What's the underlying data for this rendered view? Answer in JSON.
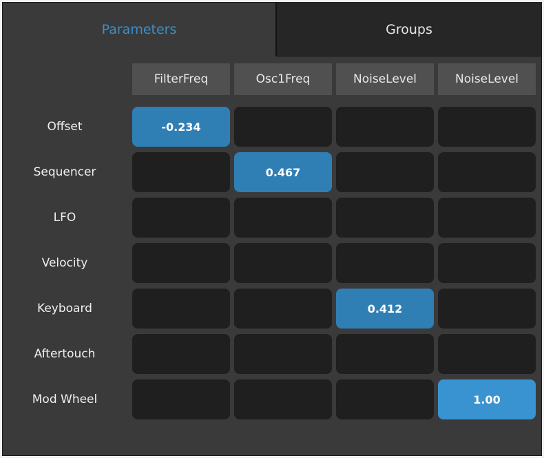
{
  "tabs": {
    "parameters": "Parameters",
    "groups": "Groups"
  },
  "columns": [
    "FilterFreq",
    "Osc1Freq",
    "NoiseLevel",
    "NoiseLevel"
  ],
  "rows": [
    {
      "label": "Offset",
      "cells": [
        "-0.234",
        "",
        "",
        ""
      ]
    },
    {
      "label": "Sequencer",
      "cells": [
        "",
        "0.467",
        "",
        ""
      ]
    },
    {
      "label": "LFO",
      "cells": [
        "",
        "",
        "",
        ""
      ]
    },
    {
      "label": "Velocity",
      "cells": [
        "",
        "",
        "",
        ""
      ]
    },
    {
      "label": "Keyboard",
      "cells": [
        "",
        "",
        "0.412",
        ""
      ]
    },
    {
      "label": "Aftertouch",
      "cells": [
        "",
        "",
        "",
        ""
      ]
    },
    {
      "label": "Mod Wheel",
      "cells": [
        "",
        "",
        "",
        "1.00"
      ]
    }
  ],
  "colors": {
    "active_tab": "#3a8fc9",
    "active_cell": "#2f7fb5",
    "empty_cell": "#1f1f1f",
    "background": "#3a3a3a"
  }
}
